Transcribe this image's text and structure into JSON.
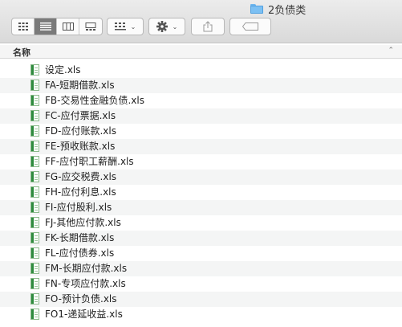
{
  "window": {
    "title": "2负债类"
  },
  "toolbar": {
    "view_buttons": [
      {
        "icon": "icon-view-icon",
        "active": false
      },
      {
        "icon": "list-view-icon",
        "active": true
      },
      {
        "icon": "column-view-icon",
        "active": false
      },
      {
        "icon": "gallery-view-icon",
        "active": false
      }
    ],
    "group_icon": "group-icon",
    "action_icon": "gear-icon",
    "share_icon": "share-icon",
    "tag_icon": "tag-icon"
  },
  "list": {
    "column_header": "名称",
    "files": [
      "设定.xls",
      "FA-短期借款.xls",
      "FB-交易性金融负债.xls",
      "FC-应付票据.xls",
      "FD-应付账款.xls",
      "FE-预收账款.xls",
      "FF-应付职工薪酬.xls",
      "FG-应交税费.xls",
      "FH-应付利息.xls",
      "FI-应付股利.xls",
      "FJ-其他应付款.xls",
      "FK-长期借款.xls",
      "FL-应付债券.xls",
      "FM-长期应付款.xls",
      "FN-专项应付款.xls",
      "FO-预计负债.xls",
      "FO1-递延收益.xls"
    ]
  },
  "colors": {
    "selected_segment": "#7a7a7a",
    "file_icon_green": "#2e8b3e",
    "folder_blue": "#7cc0f3"
  }
}
